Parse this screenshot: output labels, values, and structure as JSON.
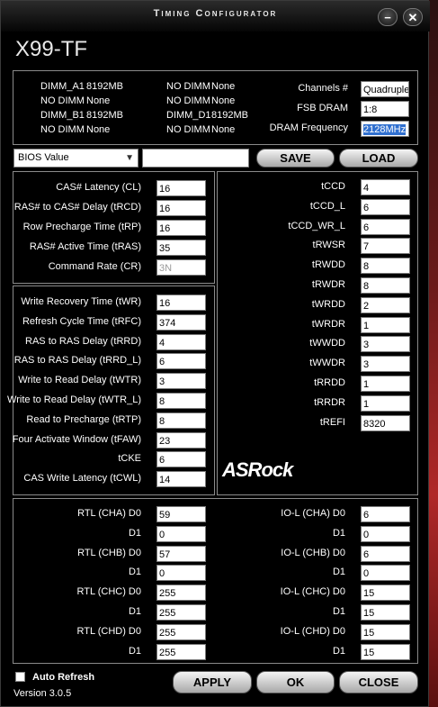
{
  "window": {
    "title": "Timing Configurator",
    "model": "X99-TF",
    "minimize_glyph": "−",
    "close_glyph": "✕",
    "version": "Version 3.0.5"
  },
  "dimms": [
    {
      "slot": "DIMM_A1",
      "size": "8192MB"
    },
    {
      "slot": "NO DIMM",
      "size": "None"
    },
    {
      "slot": "DIMM_B1",
      "size": "8192MB"
    },
    {
      "slot": "NO DIMM",
      "size": "None"
    },
    {
      "slot": "NO DIMM",
      "size": "None"
    },
    {
      "slot": "NO DIMM",
      "size": "None"
    },
    {
      "slot": "DIMM_D1",
      "size": "8192MB"
    },
    {
      "slot": "NO DIMM",
      "size": "None"
    }
  ],
  "system": {
    "channels_label": "Channels #",
    "channels_value": "Quadruple",
    "fsb_label": "FSB DRAM",
    "fsb_value": "1:8",
    "freq_label": "DRAM Frequency",
    "freq_value": "2128MHz"
  },
  "toolbar": {
    "profile_selected": "BIOS Value",
    "profile_text": "",
    "save_label": "SAVE",
    "load_label": "LOAD"
  },
  "primary": [
    {
      "label": "CAS# Latency (CL)",
      "value": "16"
    },
    {
      "label": "RAS# to CAS# Delay (tRCD)",
      "value": "16"
    },
    {
      "label": "Row Precharge Time (tRP)",
      "value": "16"
    },
    {
      "label": "RAS# Active Time (tRAS)",
      "value": "35"
    },
    {
      "label": "Command Rate (CR)",
      "value": "3N"
    }
  ],
  "secondary": [
    {
      "label": "Write Recovery Time (tWR)",
      "value": "16"
    },
    {
      "label": "Refresh Cycle Time (tRFC)",
      "value": "374"
    },
    {
      "label": "RAS to RAS Delay (tRRD)",
      "value": "4"
    },
    {
      "label": "RAS to RAS Delay (tRRD_L)",
      "value": "6"
    },
    {
      "label": "Write to Read Delay (tWTR)",
      "value": "3"
    },
    {
      "label": "Write to Read Delay (tWTR_L)",
      "value": "8"
    },
    {
      "label": "Read to Precharge (tRTP)",
      "value": "8"
    },
    {
      "label": "Four Activate Window (tFAW)",
      "value": "23"
    },
    {
      "label": "tCKE",
      "value": "6"
    },
    {
      "label": "CAS Write Latency (tCWL)",
      "value": "14"
    }
  ],
  "tertiary": [
    {
      "label": "tCCD",
      "value": "4"
    },
    {
      "label": "tCCD_L",
      "value": "6"
    },
    {
      "label": "tCCD_WR_L",
      "value": "6"
    },
    {
      "label": "tRWSR",
      "value": "7"
    },
    {
      "label": "tRWDD",
      "value": "8"
    },
    {
      "label": "tRWDR",
      "value": "8"
    },
    {
      "label": "tWRDD",
      "value": "2"
    },
    {
      "label": "tWRDR",
      "value": "1"
    },
    {
      "label": "tWWDD",
      "value": "3"
    },
    {
      "label": "tWWDR",
      "value": "3"
    },
    {
      "label": "tRRDD",
      "value": "1"
    },
    {
      "label": "tRRDR",
      "value": "1"
    },
    {
      "label": "tREFI",
      "value": "8320"
    }
  ],
  "logo_text": "ASRock",
  "rtl": [
    {
      "label": "RTL (CHA) D0",
      "value": "59"
    },
    {
      "label": "D1",
      "value": "0"
    },
    {
      "label": "RTL (CHB) D0",
      "value": "57"
    },
    {
      "label": "D1",
      "value": "0"
    },
    {
      "label": "RTL (CHC) D0",
      "value": "255"
    },
    {
      "label": "D1",
      "value": "255"
    },
    {
      "label": "RTL (CHD) D0",
      "value": "255"
    },
    {
      "label": "D1",
      "value": "255"
    }
  ],
  "iol": [
    {
      "label": "IO-L (CHA) D0",
      "value": "6"
    },
    {
      "label": "D1",
      "value": "0"
    },
    {
      "label": "IO-L (CHB) D0",
      "value": "6"
    },
    {
      "label": "D1",
      "value": "0"
    },
    {
      "label": "IO-L (CHC) D0",
      "value": "15"
    },
    {
      "label": "D1",
      "value": "15"
    },
    {
      "label": "IO-L (CHD) D0",
      "value": "15"
    },
    {
      "label": "D1",
      "value": "15"
    }
  ],
  "bottom": {
    "auto_refresh_label": "Auto Refresh",
    "apply_label": "APPLY",
    "ok_label": "OK",
    "close_label": "CLOSE"
  }
}
